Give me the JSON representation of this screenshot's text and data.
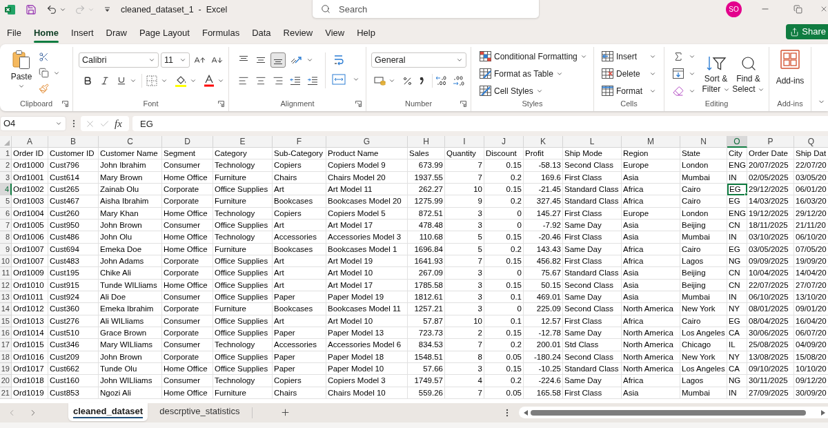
{
  "title_bar": {
    "document_title": "cleaned_dataset_1  -  Excel",
    "redo_disabled": true,
    "search": {
      "placeholder": "Search"
    },
    "avatar_initials": "SO"
  },
  "menu_tabs": [
    {
      "label": "File",
      "selected": false
    },
    {
      "label": "Home",
      "selected": true
    },
    {
      "label": "Insert",
      "selected": false
    },
    {
      "label": "Draw",
      "selected": false
    },
    {
      "label": "Page Layout",
      "selected": false
    },
    {
      "label": "Formulas",
      "selected": false
    },
    {
      "label": "Data",
      "selected": false
    },
    {
      "label": "Review",
      "selected": false
    },
    {
      "label": "View",
      "selected": false
    },
    {
      "label": "Help",
      "selected": false
    }
  ],
  "share_button": {
    "label": "Share"
  },
  "ribbon": [
    {
      "kind": "clipboard",
      "label": "Clipboard",
      "launcher": true,
      "paste_label": "Paste"
    },
    {
      "kind": "font",
      "label": "Font",
      "launcher": true,
      "font_name": "Calibri",
      "font_size": "11"
    },
    {
      "kind": "alignment",
      "label": "Alignment",
      "launcher": true,
      "vertical": [
        {
          "kind": "top",
          "selected": false
        },
        {
          "kind": "middle",
          "selected": false
        },
        {
          "kind": "bottom",
          "selected": true
        }
      ],
      "horizontal": [
        {
          "kind": "left",
          "selected": false
        },
        {
          "kind": "center",
          "selected": false
        },
        {
          "kind": "right",
          "selected": false
        }
      ]
    },
    {
      "kind": "number",
      "label": "Number",
      "launcher": true,
      "format": "General"
    },
    {
      "kind": "styles",
      "label": "Styles",
      "launcher": false,
      "commands": [
        {
          "kind": "conditional",
          "label": "Conditional Formatting"
        },
        {
          "kind": "table",
          "label": "Format as Table"
        },
        {
          "kind": "cell_styles",
          "label": "Cell Styles"
        }
      ]
    },
    {
      "kind": "cells",
      "label": "Cells",
      "launcher": false,
      "commands": [
        {
          "kind": "insert",
          "label": "Insert"
        },
        {
          "kind": "delete",
          "label": "Delete"
        },
        {
          "kind": "format",
          "label": "Format"
        }
      ]
    },
    {
      "kind": "editing",
      "label": "Editing",
      "launcher": false,
      "commands": [
        {
          "kind": "sort",
          "label": "Sort & Filter"
        },
        {
          "kind": "find",
          "label": "Find & Select"
        }
      ]
    },
    {
      "kind": "addins",
      "label": "Add-ins",
      "launcher": false,
      "commands": [
        {
          "kind": "addins",
          "label": "Add-ins"
        }
      ]
    }
  ],
  "formula_bar": {
    "name_box": "O4",
    "function_label": "fx",
    "content": "EG"
  },
  "sheet": {
    "columns": [
      {
        "letter": "A",
        "kind": "text",
        "selected": false
      },
      {
        "letter": "B",
        "kind": "text",
        "selected": false
      },
      {
        "letter": "C",
        "kind": "text",
        "selected": false
      },
      {
        "letter": "D",
        "kind": "text",
        "selected": false
      },
      {
        "letter": "E",
        "kind": "text",
        "selected": false
      },
      {
        "letter": "F",
        "kind": "text",
        "selected": false
      },
      {
        "letter": "G",
        "kind": "text",
        "selected": false
      },
      {
        "letter": "H",
        "kind": "number",
        "selected": false
      },
      {
        "letter": "I",
        "kind": "number",
        "selected": false
      },
      {
        "letter": "J",
        "kind": "number",
        "selected": false
      },
      {
        "letter": "K",
        "kind": "number",
        "selected": false
      },
      {
        "letter": "L",
        "kind": "text",
        "selected": false
      },
      {
        "letter": "M",
        "kind": "text",
        "selected": false
      },
      {
        "letter": "N",
        "kind": "text",
        "selected": false
      },
      {
        "letter": "O",
        "kind": "text",
        "selected": true
      },
      {
        "letter": "P",
        "kind": "text",
        "selected": false
      },
      {
        "letter": "Q",
        "kind": "text",
        "selected": false
      }
    ],
    "rows": [
      {
        "number": "1",
        "kind": "labels",
        "selected": false,
        "cells": [
          "Order ID",
          "Customer ID",
          "Customer Name",
          "Segment",
          "Category",
          "Sub-Category",
          "Product Name",
          "Sales",
          "Quantity",
          "Discount",
          "Profit",
          "Ship Mode",
          "Region",
          "State",
          "City",
          "Order Date",
          "Ship Dat"
        ]
      },
      {
        "number": "2",
        "kind": "record",
        "selected": false,
        "cells": [
          "Ord1000",
          "Cust796",
          "John Ibrahim",
          "Consumer",
          "Technology",
          "Copiers",
          "Copiers Model 9",
          "673.99",
          "7",
          "0.15",
          "-58.13",
          "Second Class",
          "Europe",
          "London",
          "ENG",
          "20/07/2025",
          "22/07/20"
        ]
      },
      {
        "number": "3",
        "kind": "record",
        "selected": false,
        "cells": [
          "Ord1001",
          "Cust614",
          "Mary Brown",
          "Home Office",
          "Furniture",
          "Chairs",
          "Chairs Model 20",
          "1937.55",
          "7",
          "0.2",
          "169.6",
          "First Class",
          "Asia",
          "Mumbai",
          "IN",
          "02/05/2025",
          "03/05/20"
        ]
      },
      {
        "number": "4",
        "kind": "record",
        "selected": true,
        "cells": [
          "Ord1002",
          "Cust265",
          "Zainab Olu",
          "Corporate",
          "Office Supplies",
          "Art",
          "Art Model 11",
          "262.27",
          "10",
          "0.15",
          "-21.45",
          "Standard Class",
          "Africa",
          "Cairo",
          "EG",
          "29/12/2025",
          "06/01/20"
        ]
      },
      {
        "number": "5",
        "kind": "record",
        "selected": false,
        "cells": [
          "Ord1003",
          "Cust467",
          "Aisha Ibrahim",
          "Corporate",
          "Furniture",
          "Bookcases",
          "Bookcases Model 20",
          "1275.99",
          "9",
          "0.2",
          "327.45",
          "Standard Class",
          "Africa",
          "Cairo",
          "EG",
          "14/03/2025",
          "16/03/20"
        ]
      },
      {
        "number": "6",
        "kind": "record",
        "selected": false,
        "cells": [
          "Ord1004",
          "Cust260",
          "Mary Khan",
          "Home Office",
          "Technology",
          "Copiers",
          "Copiers Model 5",
          "872.51",
          "3",
          "0",
          "145.27",
          "First Class",
          "Europe",
          "London",
          "ENG",
          "19/12/2025",
          "29/12/20"
        ]
      },
      {
        "number": "7",
        "kind": "record",
        "selected": false,
        "cells": [
          "Ord1005",
          "Cust950",
          "John Brown",
          "Consumer",
          "Office Supplies",
          "Art",
          "Art Model 17",
          "478.48",
          "3",
          "0",
          "-7.92",
          "Same Day",
          "Asia",
          "Beijing",
          "CN",
          "18/11/2025",
          "21/11/20"
        ]
      },
      {
        "number": "8",
        "kind": "record",
        "selected": false,
        "cells": [
          "Ord1006",
          "Cust486",
          "John Olu",
          "Home Office",
          "Technology",
          "Accessories",
          "Accessories Model 3",
          "110.68",
          "5",
          "0.15",
          "-20.46",
          "First Class",
          "Asia",
          "Mumbai",
          "IN",
          "03/10/2025",
          "06/10/20"
        ]
      },
      {
        "number": "9",
        "kind": "record",
        "selected": false,
        "cells": [
          "Ord1007",
          "Cust694",
          "Emeka Doe",
          "Home Office",
          "Furniture",
          "Bookcases",
          "Bookcases Model 1",
          "1696.84",
          "5",
          "0.2",
          "143.43",
          "Same Day",
          "Africa",
          "Cairo",
          "EG",
          "03/05/2025",
          "07/05/20"
        ]
      },
      {
        "number": "10",
        "kind": "record",
        "selected": false,
        "cells": [
          "Ord1007",
          "Cust483",
          "John Adams",
          "Corporate",
          "Office Supplies",
          "Art",
          "Art Model 19",
          "1641.93",
          "7",
          "0.15",
          "456.82",
          "First Class",
          "Africa",
          "Lagos",
          "NG",
          "09/09/2025",
          "19/09/20"
        ]
      },
      {
        "number": "11",
        "kind": "record",
        "selected": false,
        "cells": [
          "Ord1009",
          "Cust195",
          "Chike Ali",
          "Corporate",
          "Office Supplies",
          "Art",
          "Art Model 10",
          "267.09",
          "3",
          "0",
          "75.67",
          "Standard Class",
          "Asia",
          "Beijing",
          "CN",
          "10/04/2025",
          "14/04/20"
        ]
      },
      {
        "number": "12",
        "kind": "record",
        "selected": false,
        "cells": [
          "Ord1010",
          "Cust915",
          "Tunde WILliams",
          "Home Office",
          "Office Supplies",
          "Art",
          "Art Model 17",
          "1785.58",
          "3",
          "0.15",
          "50.15",
          "Second Class",
          "Asia",
          "Beijing",
          "CN",
          "22/07/2025",
          "27/07/20"
        ]
      },
      {
        "number": "13",
        "kind": "record",
        "selected": false,
        "cells": [
          "Ord1011",
          "Cust924",
          "Ali Doe",
          "Consumer",
          "Office Supplies",
          "Paper",
          "Paper Model 19",
          "1812.61",
          "3",
          "0.1",
          "469.01",
          "Same Day",
          "Asia",
          "Mumbai",
          "IN",
          "06/10/2025",
          "13/10/20"
        ]
      },
      {
        "number": "14",
        "kind": "record",
        "selected": false,
        "cells": [
          "Ord1012",
          "Cust360",
          "Emeka Ibrahim",
          "Corporate",
          "Furniture",
          "Bookcases",
          "Bookcases Model 11",
          "1257.21",
          "3",
          "0",
          "225.09",
          "Second Class",
          "North America",
          "New York",
          "NY",
          "08/01/2025",
          "09/01/20"
        ]
      },
      {
        "number": "15",
        "kind": "record",
        "selected": false,
        "cells": [
          "Ord1013",
          "Cust276",
          "Ali WILliams",
          "Consumer",
          "Office Supplies",
          "Art",
          "Art Model 10",
          "57.87",
          "10",
          "0.1",
          "12.57",
          "First Class",
          "Africa",
          "Cairo",
          "EG",
          "08/04/2025",
          "16/04/20"
        ]
      },
      {
        "number": "16",
        "kind": "record",
        "selected": false,
        "cells": [
          "Ord1014",
          "Cust510",
          "Grace Brown",
          "Corporate",
          "Office Supplies",
          "Paper",
          "Paper Model 13",
          "723.73",
          "2",
          "0.15",
          "-12.78",
          "Same Day",
          "North America",
          "Los Angeles",
          "CA",
          "30/06/2025",
          "06/07/20"
        ]
      },
      {
        "number": "17",
        "kind": "record",
        "selected": false,
        "cells": [
          "Ord1015",
          "Cust346",
          "Mary WILliams",
          "Consumer",
          "Technology",
          "Accessories",
          "Accessories Model 6",
          "834.53",
          "7",
          "0.2",
          "200.01",
          "Std Class",
          "North America",
          "Chicago",
          "IL",
          "25/08/2025",
          "04/09/20"
        ]
      },
      {
        "number": "18",
        "kind": "record",
        "selected": false,
        "cells": [
          "Ord1016",
          "Cust209",
          "John Brown",
          "Corporate",
          "Office Supplies",
          "Paper",
          "Paper Model 18",
          "1548.51",
          "8",
          "0.05",
          "-180.24",
          "Second Class",
          "North America",
          "New York",
          "NY",
          "13/08/2025",
          "15/08/20"
        ]
      },
      {
        "number": "19",
        "kind": "record",
        "selected": false,
        "cells": [
          "Ord1017",
          "Cust662",
          "Tunde Olu",
          "Home Office",
          "Office Supplies",
          "Paper",
          "Paper Model 10",
          "57.66",
          "3",
          "0.15",
          "-10.25",
          "Standard Class",
          "North America",
          "Los Angeles",
          "CA",
          "09/10/2025",
          "10/10/20"
        ]
      },
      {
        "number": "20",
        "kind": "record",
        "selected": false,
        "cells": [
          "Ord1018",
          "Cust160",
          "John WILliams",
          "Consumer",
          "Technology",
          "Copiers",
          "Copiers Model 3",
          "1749.57",
          "4",
          "0.2",
          "-224.6",
          "Same Day",
          "Africa",
          "Lagos",
          "NG",
          "30/11/2025",
          "09/12/20"
        ]
      },
      {
        "number": "21",
        "kind": "record",
        "selected": false,
        "cells": [
          "Ord1019",
          "Cust853",
          "Ngozi Ali",
          "Home Office",
          "Furniture",
          "Chairs",
          "Chairs Model 10",
          "559.26",
          "7",
          "0.05",
          "165.58",
          "First Class",
          "Asia",
          "Mumbai",
          "IN",
          "27/09/2025",
          "30/09/20"
        ]
      }
    ]
  },
  "sheet_tabs": [
    {
      "label": "cleaned_dataset",
      "selected": true
    },
    {
      "label": "descrptive_statistics",
      "selected": false
    }
  ]
}
